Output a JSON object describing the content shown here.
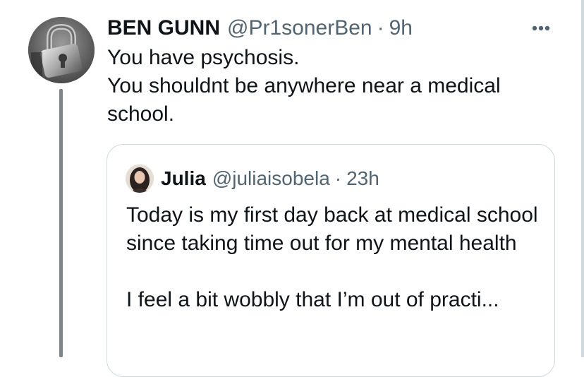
{
  "post": {
    "display_name": "BEN GUNN",
    "handle": "@Pr1sonerBen",
    "separator": "·",
    "time": "9h",
    "lines": [
      "You have psychosis.",
      "You shouldnt be anywhere near a medical school."
    ]
  },
  "quote": {
    "display_name": "Julia",
    "handle": "@juliaisobela",
    "separator": "·",
    "time": "23h",
    "paragraph1": "Today is my first day back at medical school since taking time out for my mental health",
    "paragraph2": "I feel a bit wobbly that I’m out of practi..."
  },
  "icons": {
    "more": "more-dots-icon"
  },
  "colors": {
    "text": "#0f1419",
    "secondary": "#536471",
    "border": "#cfd9de",
    "thread_line": "#7d858b"
  }
}
